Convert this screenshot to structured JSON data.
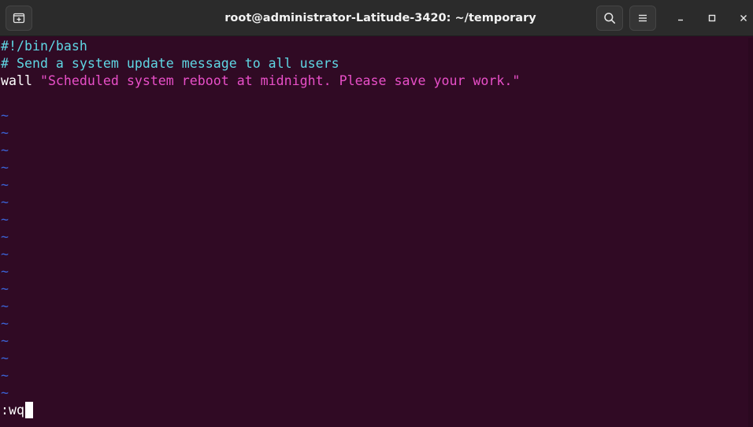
{
  "window": {
    "title": "root@administrator-Latitude-3420: ~/temporary",
    "buttons": {
      "new_tab_icon": "new-tab-icon",
      "search_icon": "search-icon",
      "menu_icon": "hamburger-menu-icon",
      "minimize_icon": "minimize-icon",
      "maximize_icon": "maximize-icon",
      "close_icon": "close-icon"
    }
  },
  "editor": {
    "lines": [
      {
        "segments": [
          {
            "text": "#!/bin/bash",
            "color": "cyan"
          }
        ]
      },
      {
        "segments": [
          {
            "text": "# Send a system update message to all users",
            "color": "cyan"
          }
        ]
      },
      {
        "segments": [
          {
            "text": "wall ",
            "color": "white"
          },
          {
            "text": "\"Scheduled system reboot at midnight. Please save your work.\"",
            "color": "magenta"
          }
        ]
      },
      {
        "segments": [
          {
            "text": "",
            "color": "white"
          }
        ]
      }
    ],
    "empty_line_marker": "~",
    "empty_line_count": 17,
    "command_line": ":wq"
  },
  "colors": {
    "background": "#300a24",
    "titlebar": "#2b2b2b",
    "cyan": "#5fd7e4",
    "magenta": "#e84fc8",
    "tilde_blue": "#3b63d6",
    "text": "#ffffff"
  }
}
